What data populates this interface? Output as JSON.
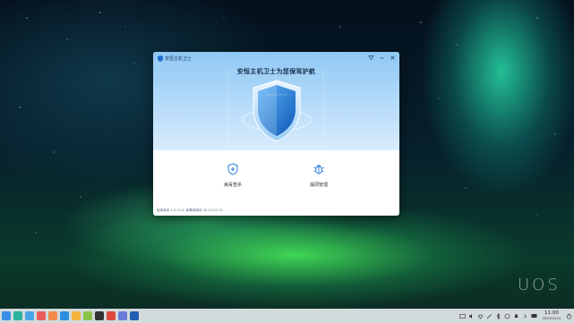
{
  "desktop": {
    "watermark": "UOS"
  },
  "window": {
    "title": "安恒主机卫士",
    "controls": [
      "settings-icon",
      "minimize-icon",
      "close-icon"
    ],
    "headline": "安恒主机卫士为您保驾护航",
    "actions": [
      {
        "label": "病毒查杀",
        "icon": "shield-plus-icon"
      },
      {
        "label": "漏洞管理",
        "icon": "bug-icon"
      }
    ],
    "version_text": "程序版本 1.0.12.4, 病毒库版本 20.10.01.13"
  },
  "taskbar": {
    "apps": [
      {
        "name": "launcher",
        "color": "#3a8ee6"
      },
      {
        "name": "multitask-view",
        "color": "#2bb39b"
      },
      {
        "name": "file-manager",
        "color": "#4aa5e8"
      },
      {
        "name": "app-store",
        "color": "#e85d5d"
      },
      {
        "name": "mail",
        "color": "#f08a4b"
      },
      {
        "name": "calendar",
        "color": "#2d8fe0"
      },
      {
        "name": "documents",
        "color": "#f4b43a"
      },
      {
        "name": "notes",
        "color": "#8bc34a"
      },
      {
        "name": "music",
        "color": "#333333"
      },
      {
        "name": "browser",
        "color": "#e0483e"
      },
      {
        "name": "settings",
        "color": "#6a7bd8"
      },
      {
        "name": "security-center",
        "color": "#1e5fb0"
      }
    ],
    "tray": [
      "keyboard-icon",
      "volume-icon",
      "network-icon",
      "pen-icon",
      "bluetooth-icon",
      "screenshot-icon",
      "notification-icon",
      "expand-icon"
    ],
    "time": "11:00",
    "date": "2020/10/14",
    "end_icons": [
      "display-icon",
      "power-icon"
    ]
  }
}
